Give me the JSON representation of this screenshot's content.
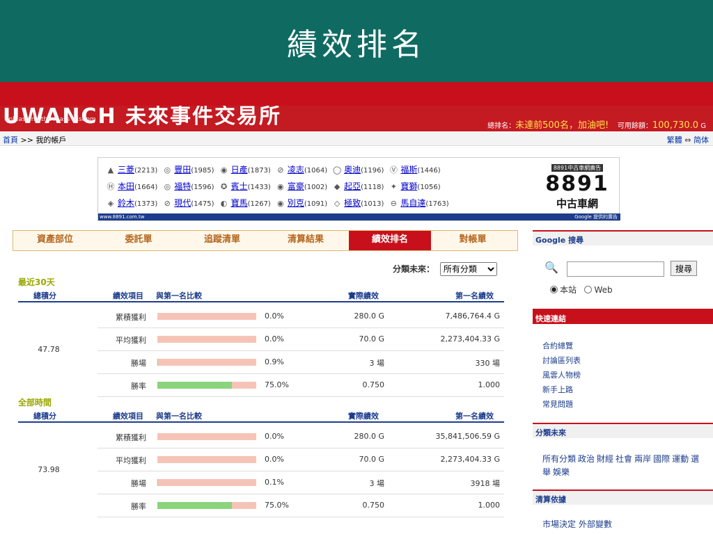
{
  "slide_title": "績效排名",
  "header": {
    "logo_text": "UWANCH 未來事件交易所",
    "tagline": "Unleashing the mass wisdom",
    "rank_label": "總排名：",
    "rank_value": "未達前500名，加油吧!",
    "balance_label": "可用餘額：",
    "balance_value": "100,730.0",
    "balance_unit": "G"
  },
  "breadcrumb": {
    "home": "首頁",
    "sep": ">>",
    "current": "我的帳戶"
  },
  "lang": {
    "trad": "繁體",
    "arrow": "⇔",
    "simp": "简体"
  },
  "ad": {
    "rows": [
      [
        {
          "icon": "▲",
          "name": "三菱",
          "count": "(2213)"
        },
        {
          "icon": "◎",
          "name": "豐田",
          "count": "(1985)"
        },
        {
          "icon": "◉",
          "name": "日產",
          "count": "(1873)"
        },
        {
          "icon": "⊘",
          "name": "凌志",
          "count": "(1064)"
        },
        {
          "icon": "◯",
          "name": "奧迪",
          "count": "(1196)"
        },
        {
          "icon": "Ⓥ",
          "name": "福斯",
          "count": "(1446)"
        }
      ],
      [
        {
          "icon": "Ⓗ",
          "name": "本田",
          "count": "(1664)"
        },
        {
          "icon": "◎",
          "name": "福特",
          "count": "(1596)"
        },
        {
          "icon": "✪",
          "name": "賓士",
          "count": "(1433)"
        },
        {
          "icon": "◉",
          "name": "富豪",
          "count": "(1002)"
        },
        {
          "icon": "◆",
          "name": "起亞",
          "count": "(1118)"
        },
        {
          "icon": "✦",
          "name": "寶獅",
          "count": "(1056)"
        }
      ],
      [
        {
          "icon": "◈",
          "name": "鈴木",
          "count": "(1373)"
        },
        {
          "icon": "⊘",
          "name": "現代",
          "count": "(1475)"
        },
        {
          "icon": "◐",
          "name": "寶馬",
          "count": "(1267)"
        },
        {
          "icon": "◉",
          "name": "別克",
          "count": "(1091)"
        },
        {
          "icon": "◇",
          "name": "極致",
          "count": "(1013)"
        },
        {
          "icon": "⊖",
          "name": "馬自達",
          "count": "(1763)"
        }
      ]
    ],
    "side_tag": "8891中古車網廣告",
    "side_big": "8891",
    "side_sub": "中古車網",
    "footer_left": "www.8891.com.tw",
    "footer_right": "Google 提供的廣告"
  },
  "tabs": [
    "資產部位",
    "委託單",
    "追蹤清單",
    "清算結果",
    "績效排名",
    "對帳單"
  ],
  "active_tab": 4,
  "filter": {
    "label": "分類未來：",
    "selected": "所有分類"
  },
  "sections": [
    {
      "title": "最近30天",
      "head": {
        "total": "總積分",
        "item": "績效項目",
        "compare": "與第一名比較",
        "actual": "實際績效",
        "first": "第一名績效"
      },
      "total_score": "47.78",
      "rows": [
        {
          "item": "累積獲利",
          "fill": 0.0,
          "pct": "0.0%",
          "actual": "280.0 G",
          "first": "7,486,764.4 G"
        },
        {
          "item": "平均獲利",
          "fill": 0.0,
          "pct": "0.0%",
          "actual": "70.0 G",
          "first": "2,273,404.33 G"
        },
        {
          "item": "勝場",
          "fill": 0.009,
          "pct": "0.9%",
          "actual": "3 場",
          "first": "330 場"
        },
        {
          "item": "勝率",
          "fill": 0.75,
          "pct": "75.0%",
          "actual": "0.750",
          "first": "1.000"
        }
      ]
    },
    {
      "title": "全部時間",
      "head": {
        "total": "總積分",
        "item": "績效項目",
        "compare": "與第一名比較",
        "actual": "實際績效",
        "first": "第一名績效"
      },
      "total_score": "73.98",
      "rows": [
        {
          "item": "累積獲利",
          "fill": 0.0,
          "pct": "0.0%",
          "actual": "280.0 G",
          "first": "35,841,506.59 G"
        },
        {
          "item": "平均獲利",
          "fill": 0.0,
          "pct": "0.0%",
          "actual": "70.0 G",
          "first": "2,273,404.33 G"
        },
        {
          "item": "勝場",
          "fill": 0.001,
          "pct": "0.1%",
          "actual": "3 場",
          "first": "3918 場"
        },
        {
          "item": "勝率",
          "fill": 0.75,
          "pct": "75.0%",
          "actual": "0.750",
          "first": "1.000"
        }
      ]
    }
  ],
  "sidebar": {
    "google_title": "Google 搜尋",
    "search_button": "搜尋",
    "radio_site": "本站",
    "radio_web": "Web",
    "quick_title": "快速連結",
    "quick_links": [
      "合約總覽",
      "討論區列表",
      "風雲人物榜",
      "新手上路",
      "常見問題"
    ],
    "cat_title": "分類未來",
    "categories": [
      "所有分類",
      "政治",
      "財經",
      "社會",
      "兩岸",
      "國際",
      "運動",
      "選舉",
      "娛樂"
    ],
    "basis_title": "清算依據",
    "basis": [
      "市場決定",
      "外部變數"
    ]
  }
}
